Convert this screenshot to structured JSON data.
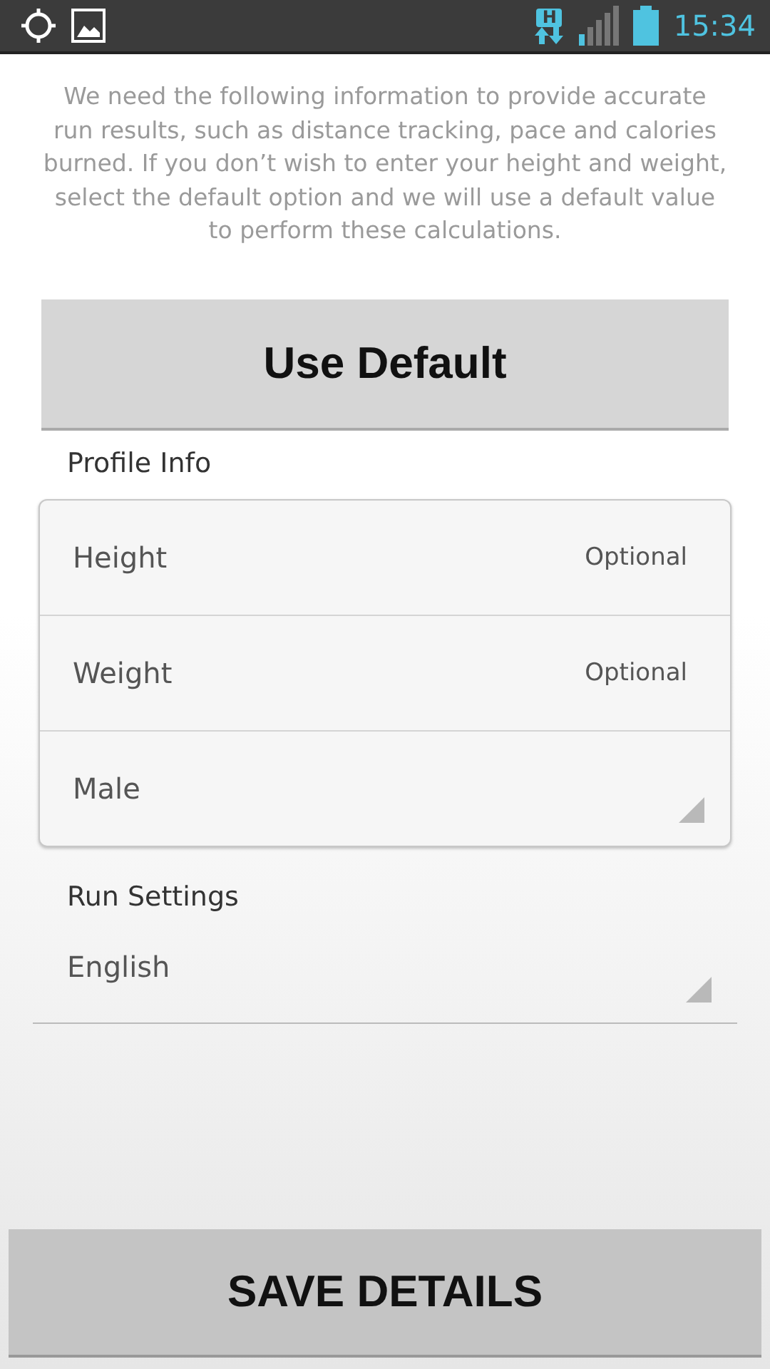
{
  "status_bar": {
    "time": "15:34",
    "network": "H"
  },
  "intro": "We need the following information to provide accurate run results, such as distance tracking, pace and calories burned. If you don’t wish to enter your height and weight, select the default option and we will use a default value to perform these calculations.",
  "default_button": "Use Default",
  "profile": {
    "title": "Profile Info",
    "fields": [
      {
        "kind": "input",
        "label": "Height",
        "placeholder": "Optional"
      },
      {
        "kind": "input",
        "label": "Weight",
        "placeholder": "Optional"
      },
      {
        "kind": "dropdown",
        "value": "Male"
      }
    ]
  },
  "run_settings": {
    "title": "Run Settings",
    "language": "English"
  },
  "save_button": "SAVE DETAILS"
}
